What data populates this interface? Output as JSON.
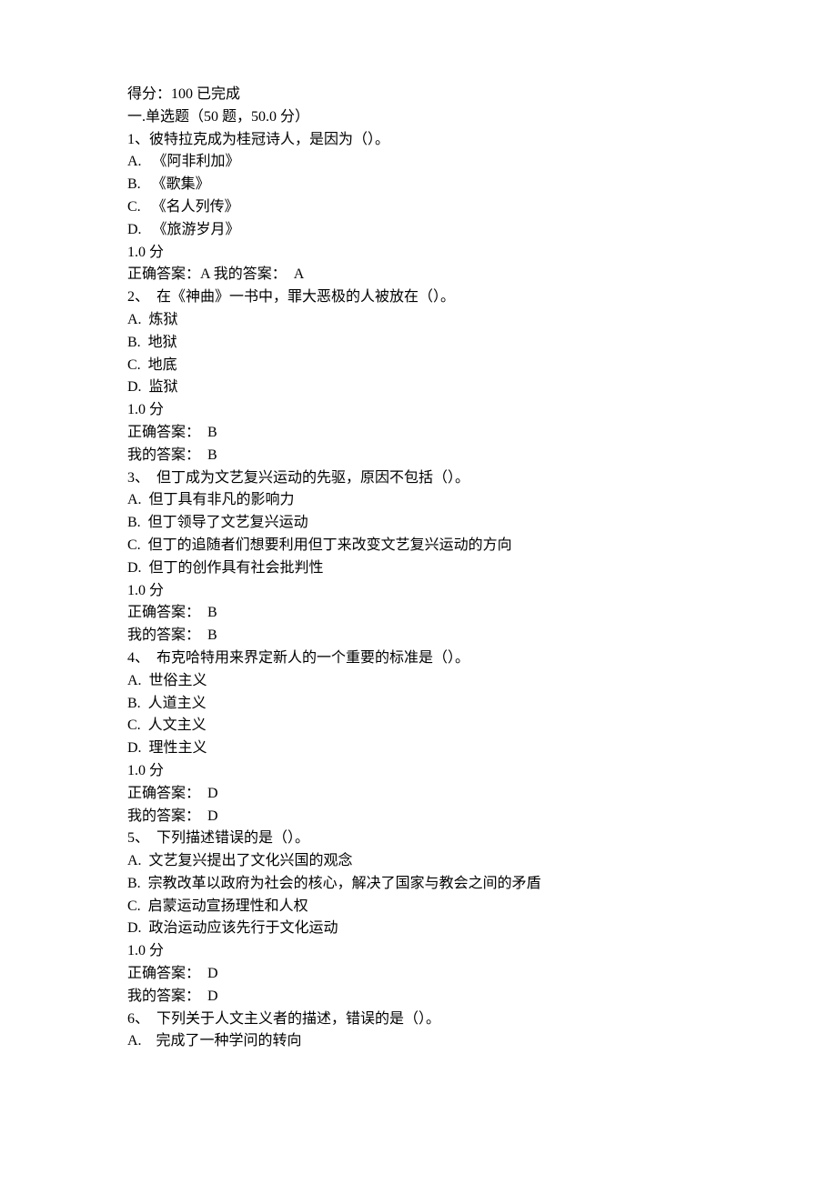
{
  "header": {
    "score_label": "得分：",
    "score_value": "100",
    "status": "已完成"
  },
  "section": {
    "title_prefix": "一.单选题（",
    "count": "50 题，",
    "points": "50.0 分）"
  },
  "labels": {
    "points_suffix": "1.0 分",
    "correct_label": "正确答案：",
    "my_label": "我的答案：",
    "correct_label_sp": "正确答案：  ",
    "my_label_sp": "我的答案：  "
  },
  "questions": [
    {
      "num": "1、",
      "stem": "彼特拉克成为桂冠诗人，是因为（）。",
      "options": [
        "A.   《阿非利加》",
        "B.   《歌集》",
        "C.   《名人列传》",
        "D.   《旅游岁月》"
      ],
      "correct_inline": "A",
      "my_inline": "A"
    },
    {
      "num": "2、  ",
      "stem": "在《神曲》一书中，罪大恶极的人被放在（）。",
      "options": [
        "A.  炼狱",
        "B.  地狱",
        "C.  地底",
        "D.  监狱"
      ],
      "correct": "B",
      "my": "B"
    },
    {
      "num": "3、  ",
      "stem": "但丁成为文艺复兴运动的先驱，原因不包括（）。",
      "options": [
        "A.  但丁具有非凡的影响力",
        "B.  但丁领导了文艺复兴运动",
        "C.  但丁的追随者们想要利用但丁来改变文艺复兴运动的方向",
        "D.  但丁的创作具有社会批判性"
      ],
      "correct": "B",
      "my": "B"
    },
    {
      "num": "4、  ",
      "stem": "布克哈特用来界定新人的一个重要的标准是（）。",
      "options": [
        "A.  世俗主义",
        "B.  人道主义",
        "C.  人文主义",
        "D.  理性主义"
      ],
      "correct": "D",
      "my": "D"
    },
    {
      "num": "5、  ",
      "stem": "下列描述错误的是（）。",
      "options": [
        "A.  文艺复兴提出了文化兴国的观念",
        "B.  宗教改革以政府为社会的核心，解决了国家与教会之间的矛盾",
        "C.  启蒙运动宣扬理性和人权",
        "D.  政治运动应该先行于文化运动"
      ],
      "correct": "D",
      "my": "D"
    },
    {
      "num": "6、  ",
      "stem": "下列关于人文主义者的描述，错误的是（）。",
      "options": [
        "A.    完成了一种学问的转向"
      ],
      "correct": null,
      "my": null
    }
  ]
}
